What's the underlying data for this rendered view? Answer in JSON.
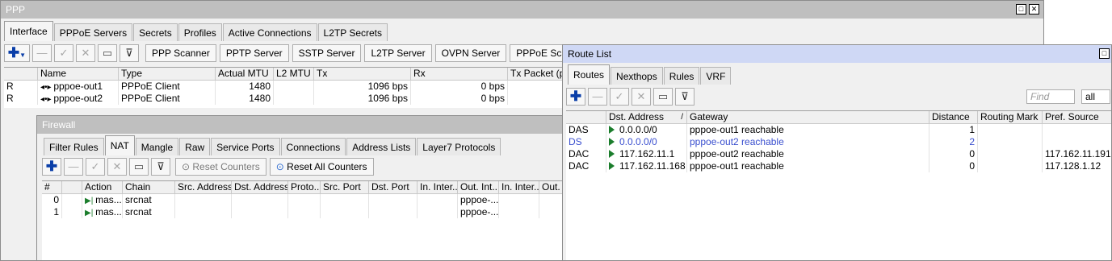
{
  "ppp": {
    "title": "PPP",
    "tabs": [
      "Interface",
      "PPPoE Servers",
      "Secrets",
      "Profiles",
      "Active Connections",
      "L2TP Secrets"
    ],
    "buttons": [
      "PPP Scanner",
      "PPTP Server",
      "SSTP Server",
      "L2TP Server",
      "OVPN Server",
      "PPPoE Scan"
    ],
    "columns": [
      "",
      "Name",
      "Type",
      "Actual MTU",
      "L2 MTU",
      "Tx",
      "Rx",
      "Tx Packet (p/"
    ],
    "rows": [
      {
        "flag": "R",
        "name": "pppoe-out1",
        "type": "PPPoE Client",
        "mtu": "1480",
        "l2mtu": "",
        "tx": "1096 bps",
        "rx": "0 bps",
        "txp": ""
      },
      {
        "flag": "R",
        "name": "pppoe-out2",
        "type": "PPPoE Client",
        "mtu": "1480",
        "l2mtu": "",
        "tx": "1096 bps",
        "rx": "0 bps",
        "txp": ""
      }
    ]
  },
  "firewall": {
    "title": "Firewall",
    "tabs": [
      "Filter Rules",
      "NAT",
      "Mangle",
      "Raw",
      "Service Ports",
      "Connections",
      "Address Lists",
      "Layer7 Protocols"
    ],
    "reset_counters": "Reset Counters",
    "reset_all_counters": "Reset All Counters",
    "columns": [
      "#",
      "",
      "Action",
      "Chain",
      "Src. Address",
      "Dst. Address",
      "Proto...",
      "Src. Port",
      "Dst. Port",
      "In. Inter...",
      "Out. Int...",
      "In. Inter...",
      "Out. I"
    ],
    "rows": [
      {
        "num": "0",
        "action": "mas...",
        "chain": "srcnat",
        "out": "pppoe-..."
      },
      {
        "num": "1",
        "action": "mas...",
        "chain": "srcnat",
        "out": "pppoe-..."
      }
    ]
  },
  "routes": {
    "title": "Route List",
    "tabs": [
      "Routes",
      "Nexthops",
      "Rules",
      "VRF"
    ],
    "find_placeholder": "Find",
    "filter_value": "all",
    "columns": [
      "",
      "Dst. Address",
      "Gateway",
      "Distance",
      "Routing Mark",
      "Pref. Source"
    ],
    "rows": [
      {
        "flags": "DAS",
        "dst": "0.0.0.0/0",
        "gateway": "pppoe-out1 reachable",
        "distance": "1",
        "mark": "",
        "pref": ""
      },
      {
        "flags": "DS",
        "dst": "0.0.0.0/0",
        "gateway": "pppoe-out2 reachable",
        "distance": "2",
        "mark": "",
        "pref": ""
      },
      {
        "flags": "DAC",
        "dst": "117.162.11.1",
        "gateway": "pppoe-out2 reachable",
        "distance": "0",
        "mark": "",
        "pref": "117.162.11.191"
      },
      {
        "flags": "DAC",
        "dst": "117.162.11.168",
        "gateway": "pppoe-out1 reachable",
        "distance": "0",
        "mark": "",
        "pref": "117.128.1.12"
      }
    ]
  }
}
